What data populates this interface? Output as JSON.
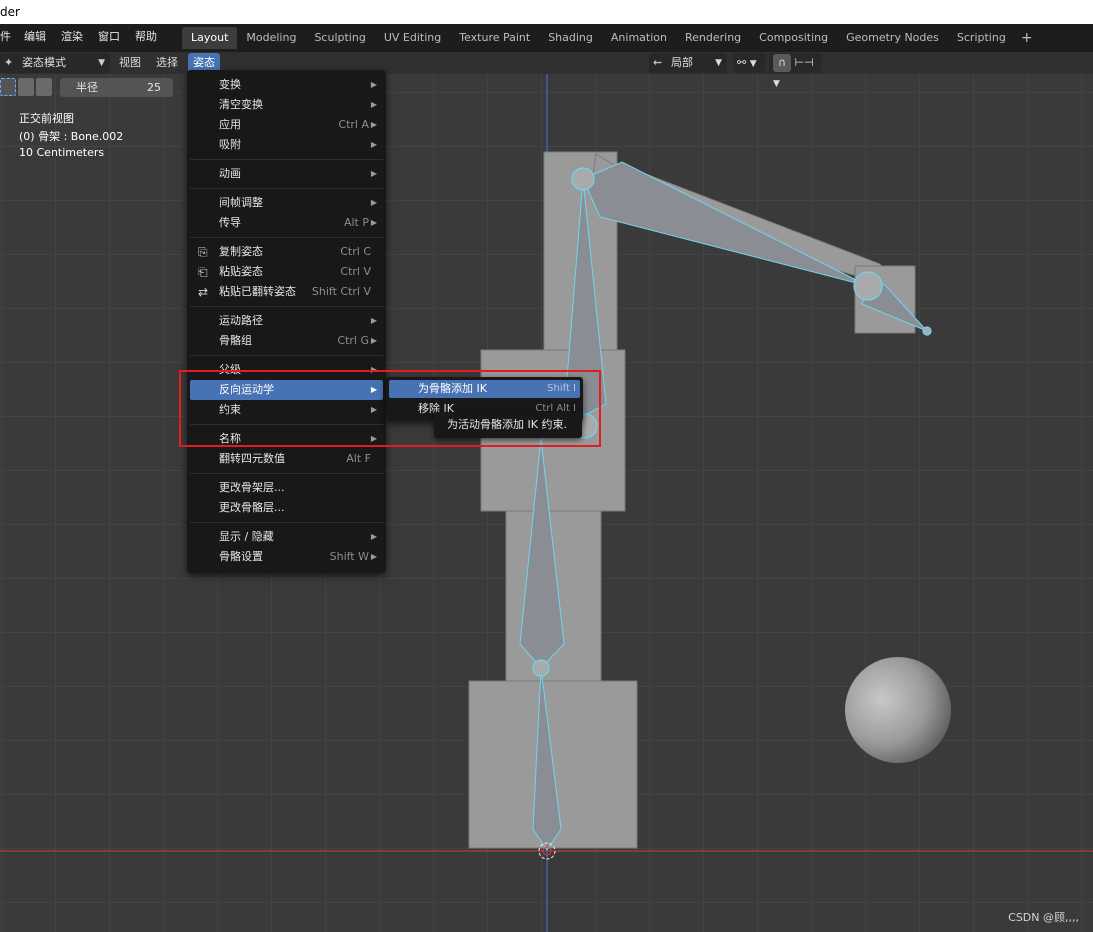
{
  "window": {
    "title": "der"
  },
  "main_menu": [
    "件",
    "编辑",
    "渲染",
    "窗口",
    "帮助"
  ],
  "workspaces": {
    "tabs": [
      "Layout",
      "Modeling",
      "Sculpting",
      "UV Editing",
      "Texture Paint",
      "Shading",
      "Animation",
      "Rendering",
      "Compositing",
      "Geometry Nodes",
      "Scripting"
    ],
    "active": "Layout",
    "add_label": "+"
  },
  "header": {
    "mode": "姿态模式",
    "view_menu": "视图",
    "select_menu": "选择",
    "pose_menu": "姿态",
    "pivot_label": "局部"
  },
  "toolbar": {
    "radius_label": "半径",
    "radius_value": "25"
  },
  "viewport": {
    "view_name": "正交前视图",
    "active_object": "(0) 骨架 : Bone.002",
    "scale": "10 Centimeters"
  },
  "pose_menu": {
    "items": [
      {
        "label": "变换",
        "shortcut": "",
        "submenu": true
      },
      {
        "label": "清空变换",
        "shortcut": "",
        "submenu": true
      },
      {
        "label": "应用",
        "shortcut": "Ctrl A",
        "submenu": true
      },
      {
        "label": "吸附",
        "shortcut": "",
        "submenu": true
      },
      {
        "label": "动画",
        "shortcut": "",
        "submenu": true
      },
      {
        "label": "间帧调整",
        "shortcut": "",
        "submenu": true
      },
      {
        "label": "传导",
        "shortcut": "Alt P",
        "submenu": true
      },
      {
        "label": "复制姿态",
        "shortcut": "Ctrl C",
        "submenu": false
      },
      {
        "label": "粘贴姿态",
        "shortcut": "Ctrl V",
        "submenu": false
      },
      {
        "label": "粘贴已翻转姿态",
        "shortcut": "Shift Ctrl V",
        "submenu": false
      },
      {
        "label": "运动路径",
        "shortcut": "",
        "submenu": true
      },
      {
        "label": "骨骼组",
        "shortcut": "Ctrl G",
        "submenu": true
      },
      {
        "label": "父级",
        "shortcut": "",
        "submenu": true
      },
      {
        "label": "反向运动学",
        "shortcut": "",
        "submenu": true
      },
      {
        "label": "约束",
        "shortcut": "",
        "submenu": true
      },
      {
        "label": "名称",
        "shortcut": "",
        "submenu": true
      },
      {
        "label": "翻转四元数值",
        "shortcut": "Alt F",
        "submenu": false
      },
      {
        "label": "更改骨架层...",
        "shortcut": "",
        "submenu": false
      },
      {
        "label": "更改骨骼层...",
        "shortcut": "",
        "submenu": false
      },
      {
        "label": "显示 / 隐藏",
        "shortcut": "",
        "submenu": true
      },
      {
        "label": "骨骼设置",
        "shortcut": "Shift W",
        "submenu": true
      }
    ],
    "active_item": "反向运动学"
  },
  "ik_submenu": {
    "items": [
      {
        "label": "为骨骼添加 IK",
        "shortcut": "Shift I"
      },
      {
        "label": "移除 IK",
        "shortcut": "Ctrl Alt I"
      }
    ]
  },
  "tooltip": {
    "text": "为活动骨骼添加 IK 约束."
  },
  "watermark": {
    "text": "CSDN @顾,,,,"
  },
  "colors": {
    "accent": "#4772b3",
    "highlight_box": "#e01e1e",
    "bone_outline": "#6fd6f0",
    "x_axis": "#b33a3a",
    "z_axis": "#3a6fb3"
  },
  "icons": {
    "mode": "pose-mode-icon",
    "pivot": "pivot-icon",
    "snap": "magnet-icon",
    "proportional": "proportional-icon"
  }
}
